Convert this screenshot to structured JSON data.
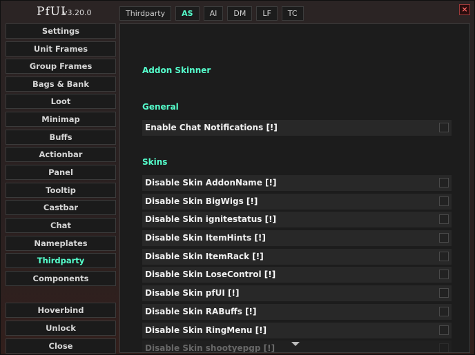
{
  "app": {
    "logo": "PfUI",
    "version": "v3.20.0"
  },
  "tabs": [
    {
      "label": "Thirdparty",
      "active": false
    },
    {
      "label": "AS",
      "active": true
    },
    {
      "label": "AI",
      "active": false
    },
    {
      "label": "DM",
      "active": false
    },
    {
      "label": "LF",
      "active": false
    },
    {
      "label": "TC",
      "active": false
    }
  ],
  "close_glyph": "×",
  "sidebar": {
    "items": [
      {
        "label": "Settings"
      },
      {
        "label": "Unit Frames"
      },
      {
        "label": "Group Frames"
      },
      {
        "label": "Bags & Bank"
      },
      {
        "label": "Loot"
      },
      {
        "label": "Minimap"
      },
      {
        "label": "Buffs"
      },
      {
        "label": "Actionbar"
      },
      {
        "label": "Panel"
      },
      {
        "label": "Tooltip"
      },
      {
        "label": "Castbar"
      },
      {
        "label": "Chat"
      },
      {
        "label": "Nameplates"
      },
      {
        "label": "Thirdparty",
        "active": true
      },
      {
        "label": "Components"
      }
    ],
    "bottom": [
      {
        "label": "Hoverbind"
      },
      {
        "label": "Unlock"
      },
      {
        "label": "Close"
      }
    ]
  },
  "content": {
    "title": "Addon Skinner",
    "general": {
      "heading": "General",
      "rows": [
        {
          "label": "Enable Chat Notifications",
          "flag": "[!]"
        }
      ]
    },
    "skins": {
      "heading": "Skins",
      "rows": [
        {
          "label": "Disable Skin AddonName",
          "flag": "[!]"
        },
        {
          "label": "Disable Skin BigWigs",
          "flag": "[!]"
        },
        {
          "label": "Disable Skin ignitestatus",
          "flag": "[!]"
        },
        {
          "label": "Disable Skin ItemHints",
          "flag": "[!]"
        },
        {
          "label": "Disable Skin ItemRack",
          "flag": "[!]"
        },
        {
          "label": "Disable Skin LoseControl",
          "flag": "[!]"
        },
        {
          "label": "Disable Skin pfUI",
          "flag": "[!]"
        },
        {
          "label": "Disable Skin RABuffs",
          "flag": "[!]"
        },
        {
          "label": "Disable Skin RingMenu",
          "flag": "[!]"
        },
        {
          "label": "Disable Skin shootyepgp",
          "flag": "[!]"
        }
      ]
    }
  },
  "colors": {
    "accent": "#55ffcc",
    "panel": "#1c1c1c",
    "row": "#282828"
  }
}
